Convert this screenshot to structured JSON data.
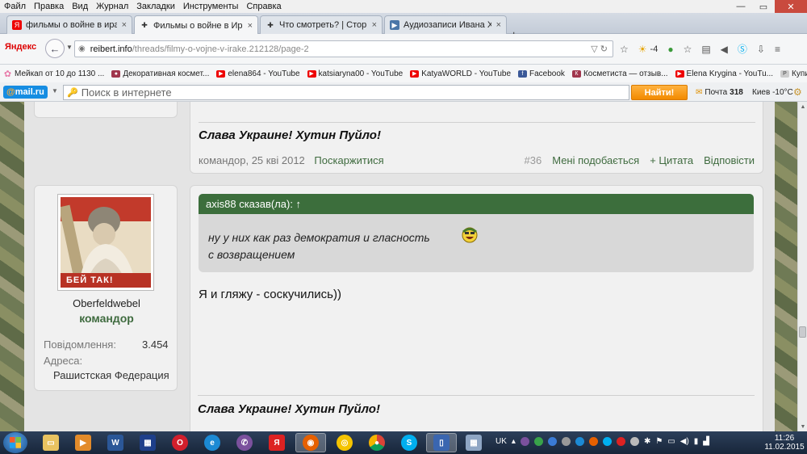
{
  "menu": [
    "Файл",
    "Правка",
    "Вид",
    "Журнал",
    "Закладки",
    "Инструменты",
    "Справка"
  ],
  "window_controls": {
    "minimize": "—",
    "maximize": "▭",
    "close": "✕"
  },
  "tabs": [
    {
      "title": "фильмы о войне в ираке ...",
      "close": "×"
    },
    {
      "title": "Фильмы о войне в Ираке ...",
      "close": "×",
      "active": true
    },
    {
      "title": "Что смотреть? | Сторінка ...",
      "close": "×"
    },
    {
      "title": "Аудиозаписи Ивана Хорват...",
      "close": "×"
    }
  ],
  "new_tab": "+",
  "nav": {
    "logo": "Яндекс",
    "back": "←",
    "url_domain": "reibert.info",
    "url_path": "/threads/filmy-o-vojne-v-irake.212128/page-2",
    "weather_temp": "-4"
  },
  "bookmarks": [
    {
      "label": "Мейкап от 10 до 1130 ..."
    },
    {
      "label": "Декоративная космет..."
    },
    {
      "label": "elena864 - YouTube"
    },
    {
      "label": "katsiaryna00 - YouTube"
    },
    {
      "label": "KatyaWORLD - YouTube"
    },
    {
      "label": "Facebook"
    },
    {
      "label": "Косметиста — отзыв..."
    },
    {
      "label": "Elena Krygina - YouTu..."
    },
    {
      "label": "Купить женские босо..."
    }
  ],
  "mailbar": {
    "logo_at": "@",
    "logo_text": "mail.ru",
    "search_placeholder": "Поиск в интернете",
    "find_button": "Найти!",
    "mail_label": "Почта",
    "mail_count": "318",
    "weather": "Киев -10°C"
  },
  "post1": {
    "signature": "Слава Украине! Хутин Пуйло!",
    "author": "командор",
    "date": "25 кві 2012",
    "report": "Поскаржитися",
    "number": "#36",
    "like": "Мені подобається",
    "quote": "+ Цитата",
    "reply": "Відповісти"
  },
  "post2": {
    "username": "Oberfeldwebel",
    "rank": "командор",
    "messages_label": "Повідомлення:",
    "messages_value": "3.454",
    "address_label": "Адреса:",
    "address_value": "Рашистская Федерация",
    "avatar_caption": "БЕЙ ТАК!",
    "quote_header": "axis88 сказав(ла): ↑",
    "quote_line1": "ну у них как раз демократия и гласность",
    "quote_line2": "с возвращением",
    "text": "Я и гляжу - соскучились))",
    "signature": "Слава Украине! Хутин Пуйло!"
  },
  "taskbar": {
    "tray_lang": "UK",
    "clock_time": "11:26",
    "clock_date": "11.02.2015"
  }
}
